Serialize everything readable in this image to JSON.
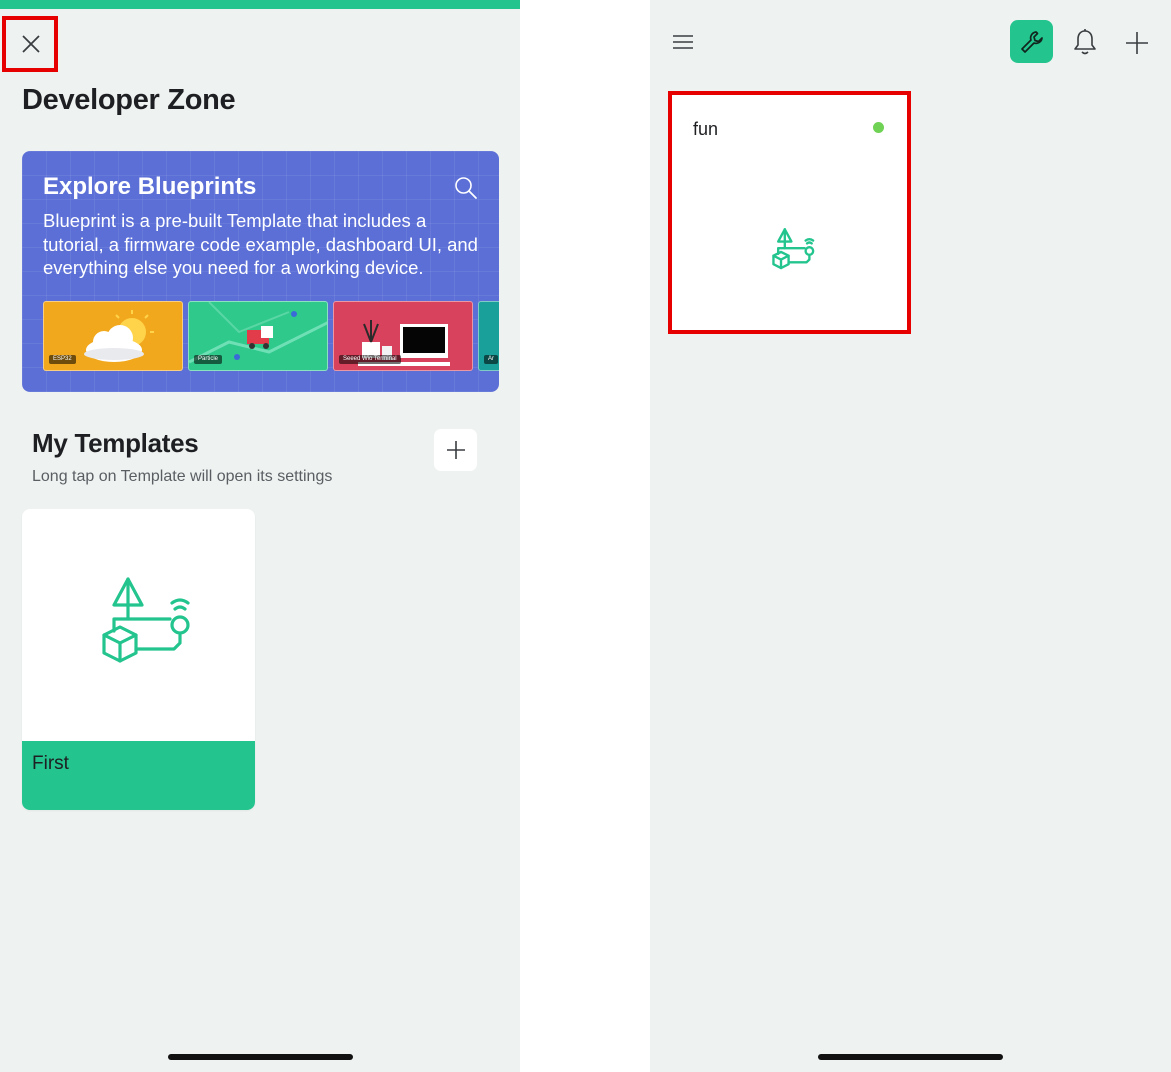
{
  "left_screen": {
    "title": "Developer Zone",
    "close_icon": "close-icon",
    "blueprints": {
      "title": "Explore Blueprints",
      "description": "Blueprint is a pre-built Template that includes a tutorial, a firmware code example, dashboard UI, and everything else you need for a working device.",
      "search_icon": "search-icon",
      "thumbnails": [
        {
          "tag": "ESP32",
          "color": "#f2a81c"
        },
        {
          "tag": "Particle",
          "color": "#2fc98c"
        },
        {
          "tag": "Seeed Wio Terminal",
          "color": "#d9425c"
        },
        {
          "tag": "Ar",
          "color": "#1aa09a"
        }
      ]
    },
    "templates": {
      "title": "My Templates",
      "subtitle": "Long tap on Template will open its settings",
      "add_icon": "plus-icon",
      "items": [
        {
          "name": "First"
        }
      ]
    }
  },
  "right_screen": {
    "menu_icon": "hamburger-menu-icon",
    "wrench_icon": "wrench-icon",
    "bell_icon": "bell-icon",
    "add_icon": "plus-icon",
    "devices": [
      {
        "name": "fun",
        "status": "online",
        "status_color": "#6fd254"
      }
    ]
  },
  "colors": {
    "accent": "#23c48e",
    "blueprint_bg": "#5b6fd6",
    "background": "#eef2f0",
    "highlight": "#e60000"
  }
}
